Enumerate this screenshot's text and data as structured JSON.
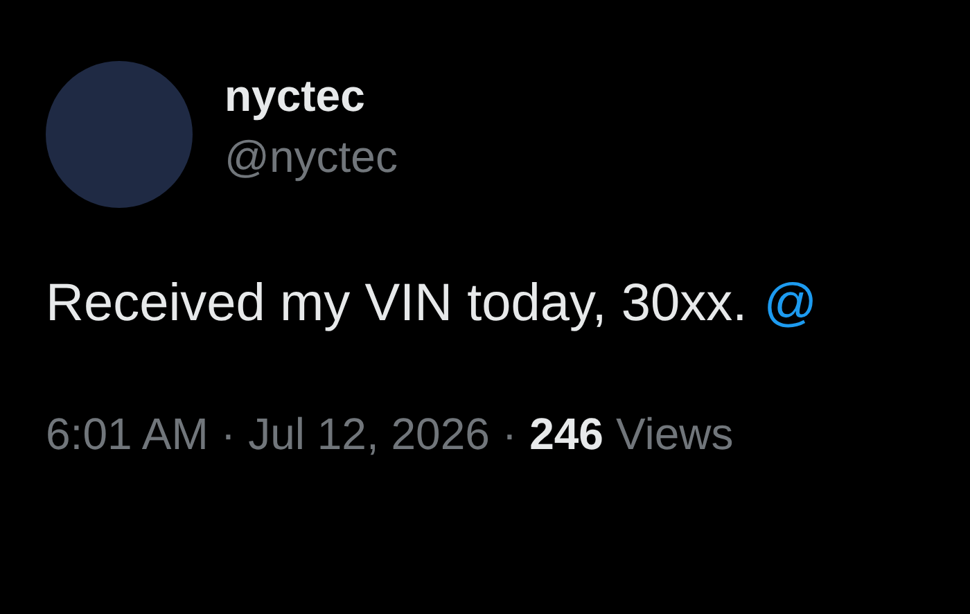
{
  "author": {
    "name": "nyctec",
    "handle": "@nyctec"
  },
  "tweet": {
    "text": "Received my VIN today, 30xx.",
    "mention": "@"
  },
  "meta": [
    {
      "kind": "text",
      "text": "6:01 AM"
    },
    {
      "kind": "sep",
      "text": "·"
    },
    {
      "kind": "text",
      "text": "Jul 12, 2026"
    },
    {
      "kind": "sep",
      "text": "·"
    },
    {
      "kind": "count",
      "text": "246"
    },
    {
      "kind": "text",
      "text": "Views"
    }
  ]
}
